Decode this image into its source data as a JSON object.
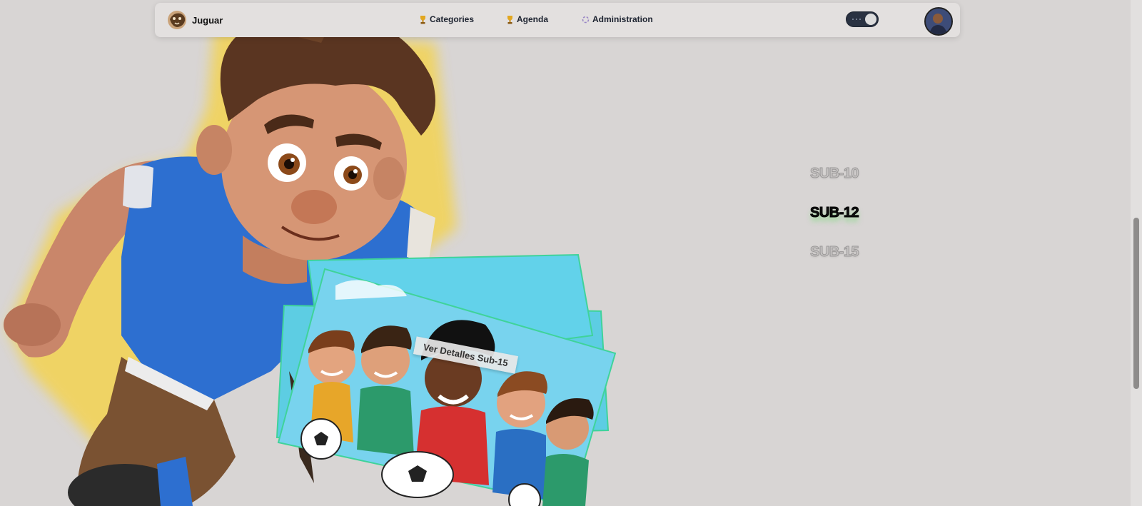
{
  "navbar": {
    "brand_name": "Juguar",
    "links": [
      {
        "label": "Categories",
        "icon": "trophy-icon"
      },
      {
        "label": "Agenda",
        "icon": "trophy-icon"
      },
      {
        "label": "Administration",
        "icon": "spinner-icon"
      }
    ],
    "theme_toggle": {
      "state": "dark"
    }
  },
  "categories": {
    "items": [
      "SUB-10",
      "SUB-12",
      "SUB-15"
    ],
    "active": "SUB-12"
  },
  "card_stack": {
    "tooltip": "Ver Detalles Sub-15"
  },
  "colors": {
    "background": "#d8d5d4",
    "card_border": "#3fd39a",
    "hero_glow": "#f5d34a",
    "active_shadow": "#5adc5a"
  }
}
